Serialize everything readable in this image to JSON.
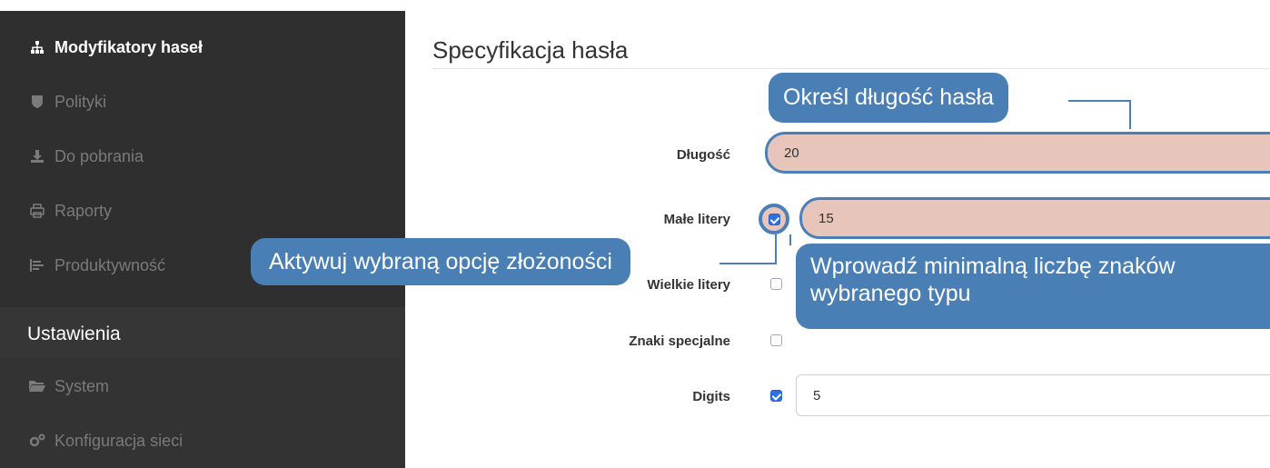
{
  "sidebar": {
    "items": [
      {
        "label": "Modyfikatory haseł",
        "icon": "sitemap-icon"
      },
      {
        "label": "Polityki",
        "icon": "shield-icon"
      },
      {
        "label": "Do pobrania",
        "icon": "download-icon"
      },
      {
        "label": "Raporty",
        "icon": "print-icon"
      },
      {
        "label": "Produktywność",
        "icon": "chart-icon"
      }
    ],
    "section_label": "Ustawienia",
    "section_items": [
      {
        "label": "System",
        "icon": "folder-icon"
      },
      {
        "label": "Konfiguracja sieci",
        "icon": "cogs-icon"
      }
    ]
  },
  "panel": {
    "title": "Specyfikacja hasła"
  },
  "form": {
    "length_label": "Długość",
    "length_value": "20",
    "lowercase_label": "Małe litery",
    "lowercase_value": "15",
    "uppercase_label": "Wielkie litery",
    "special_label": "Znaki specjalne",
    "digits_label": "Digits",
    "digits_value": "5"
  },
  "callouts": {
    "length": "Określ długość hasła",
    "activate": "Aktywuj wybraną opcję złożoności",
    "minimum_line1": "Wprowadź minimalną liczbę znaków",
    "minimum_line2": "wybranego typu"
  },
  "colors": {
    "sidebar_bg": "#2f2f2f",
    "callout_bg": "#4a7fb5",
    "highlight_fill": "#e8c5bb",
    "checkbox_on": "#2f6fdf"
  }
}
